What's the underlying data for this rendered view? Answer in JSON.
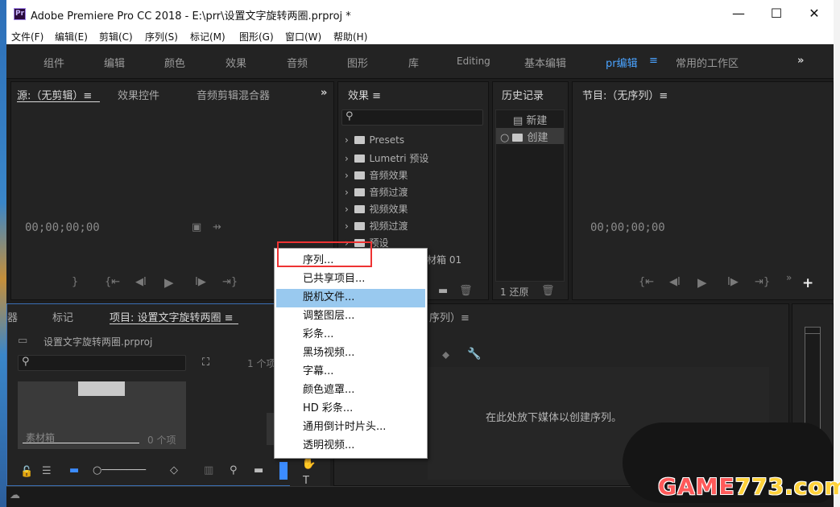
{
  "window": {
    "app_icon": "Pr",
    "title": "Adobe Premiere Pro CC 2018 - E:\\prr\\设置文字旋转两圈.prproj *",
    "minimize": "—",
    "maximize": "☐",
    "close": "✕"
  },
  "menubar": [
    "文件(F)",
    "编辑(E)",
    "剪辑(C)",
    "序列(S)",
    "标记(M)",
    "图形(G)",
    "窗口(W)",
    "帮助(H)"
  ],
  "workspaces": [
    "组件",
    "编辑",
    "颜色",
    "效果",
    "音频",
    "图形",
    "库",
    "Editing",
    "基本编辑",
    "pr编辑",
    "常用的工作区"
  ],
  "workspace_active_menu": "≡",
  "workspace_more": "»",
  "source_panel": {
    "tabs": [
      "源:（无剪辑）≡",
      "效果控件",
      "音频剪辑混合器"
    ],
    "more": "»",
    "timecode": "00;00;00;00"
  },
  "effects_panel": {
    "title": "效果 ≡",
    "items": [
      "Presets",
      "Lumetri 预设",
      "音频效果",
      "音频过渡",
      "视频效果",
      "视频过渡",
      "预设"
    ],
    "partial_item": "材箱 01"
  },
  "history_panel": {
    "title": "历史记录",
    "items": [
      "新建",
      "创建"
    ],
    "footer": "1 还原"
  },
  "program_panel": {
    "title": "节目:（无序列）≡",
    "timecode": "00;00;00;00"
  },
  "project_panel": {
    "tabs": [
      "器",
      "标记",
      "项目: 设置文字旋转两圈 ≡"
    ],
    "file": "设置文字旋转两圈.prproj",
    "item_count": "1 个项",
    "bin_label": "素材箱",
    "bin_count": "0 个项"
  },
  "timeline_panel": {
    "title_partial": "序列）≡",
    "drop_hint": "在此处放下媒体以创建序列。"
  },
  "context_menu": {
    "items": [
      "序列...",
      "已共享项目...",
      "脱机文件...",
      "调整图层...",
      "彩条...",
      "黑场视频...",
      "字幕...",
      "颜色遮罩...",
      "HD 彩条...",
      "通用倒计时片头...",
      "透明视频..."
    ],
    "highlighted_index": 2
  },
  "watermark": {
    "text_a": "GAME",
    "text_b": "773",
    "text_c": ".com"
  },
  "colors": {
    "accent": "#4aa3ff",
    "menu_highlight": "#99c9ef",
    "red_annotation": "#e33333"
  }
}
